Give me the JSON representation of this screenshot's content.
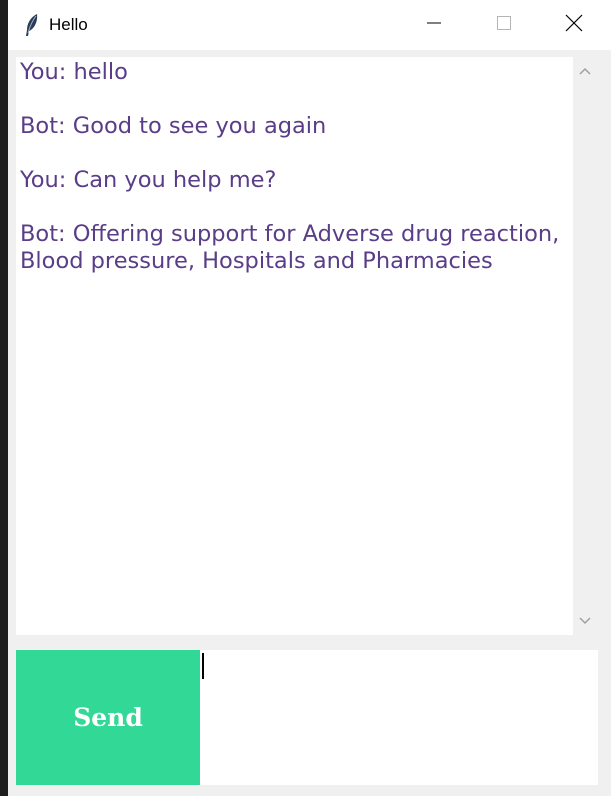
{
  "window": {
    "title": "Hello",
    "icon": "feather-icon",
    "controls": [
      "minimize-icon",
      "maximize-icon",
      "close-icon"
    ]
  },
  "chat": {
    "messages": [
      "You: hello",
      "",
      "Bot: Good to see you again",
      "",
      "You: Can you help me?",
      "",
      "Bot: Offering support for Adverse drug reaction, Blood pressure, Hospitals and Pharmacies"
    ],
    "text_color": "#5a3d88"
  },
  "input": {
    "value": ""
  },
  "send_button": {
    "label": "Send",
    "color": "#32d996"
  }
}
